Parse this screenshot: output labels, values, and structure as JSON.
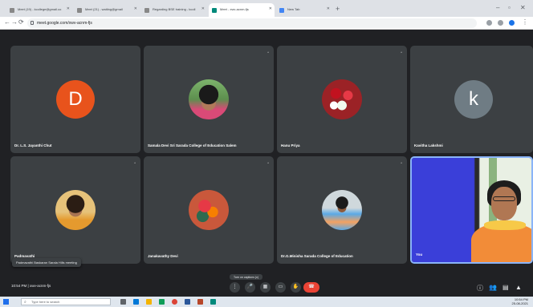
{
  "browser": {
    "tabs": [
      {
        "label": "Meet (19) - kcollege@gmail.co",
        "active": false
      },
      {
        "label": "Meet (21) - waiting@gmail",
        "active": false
      },
      {
        "label": "Regarding BSE training - kcoll",
        "active": false
      },
      {
        "label": "Meet - xwv-acnm-fjs",
        "active": true
      },
      {
        "label": "New Tab",
        "active": false
      }
    ],
    "address": "meet.google.com/xwv-acnm-fjs"
  },
  "meet": {
    "participants": [
      {
        "name": "Dr. L.S. Jayanthi Chut",
        "type": "initial",
        "initial": "D",
        "color": "#e8531c",
        "pinned": false
      },
      {
        "name": "Samala Devi Sri Sarada College of Education Salem",
        "type": "photo",
        "photo": "woman-saree-portrait",
        "pinned": true
      },
      {
        "name": "Hanu Priya",
        "type": "photo",
        "photo": "white-and-red-flowers",
        "pinned": true
      },
      {
        "name": "Kavitha Lakshmi",
        "type": "initial",
        "initial": "k",
        "color": "#6f7c84",
        "pinned": false
      },
      {
        "name": "Padmavathi",
        "type": "photo",
        "photo": "woman-portrait-yellow",
        "pinned": true
      },
      {
        "name": "Janakavathy Devi",
        "type": "photo",
        "photo": "red-flower-bouquet",
        "pinned": true
      },
      {
        "name": "Dr.G.Minisha Sarada College of Education",
        "type": "photo",
        "photo": "woman-blue-saree",
        "pinned": true
      },
      {
        "name": "You",
        "type": "video",
        "photo": "presenter-camera-feed",
        "pinned": false
      }
    ],
    "tooltip": "Padmavathi Baskaran Sarala Hills meeting",
    "meeting_info": {
      "time": "10:54 PM",
      "separator": "|",
      "code": "xwv-acnm-fjs"
    },
    "caption_pill": "Turn on captions (c)",
    "controls": [
      {
        "name": "more-options-icon",
        "glyph": "⋮"
      },
      {
        "name": "microphone-icon",
        "glyph": "🎤"
      },
      {
        "name": "camera-icon",
        "glyph": "▦"
      },
      {
        "name": "captions-icon",
        "glyph": "▭"
      },
      {
        "name": "present-icon",
        "glyph": "▣"
      },
      {
        "name": "raise-hand-icon",
        "glyph": "✋"
      }
    ],
    "end_call_glyph": "☎",
    "right_icons": [
      {
        "name": "info-icon",
        "glyph": "ⓘ"
      },
      {
        "name": "people-icon",
        "glyph": "👥"
      },
      {
        "name": "chat-icon",
        "glyph": "▤"
      },
      {
        "name": "activities-icon",
        "glyph": "▲"
      }
    ]
  },
  "taskbar": {
    "search_placeholder": "Type here to search",
    "tray_time": "10:54 PM",
    "tray_date": "25-08-2021"
  },
  "colors": {
    "meet_bg": "#202124",
    "tile_bg": "#3c4043",
    "end_call": "#ea4335",
    "active_speaker": "#8ab4f8"
  }
}
